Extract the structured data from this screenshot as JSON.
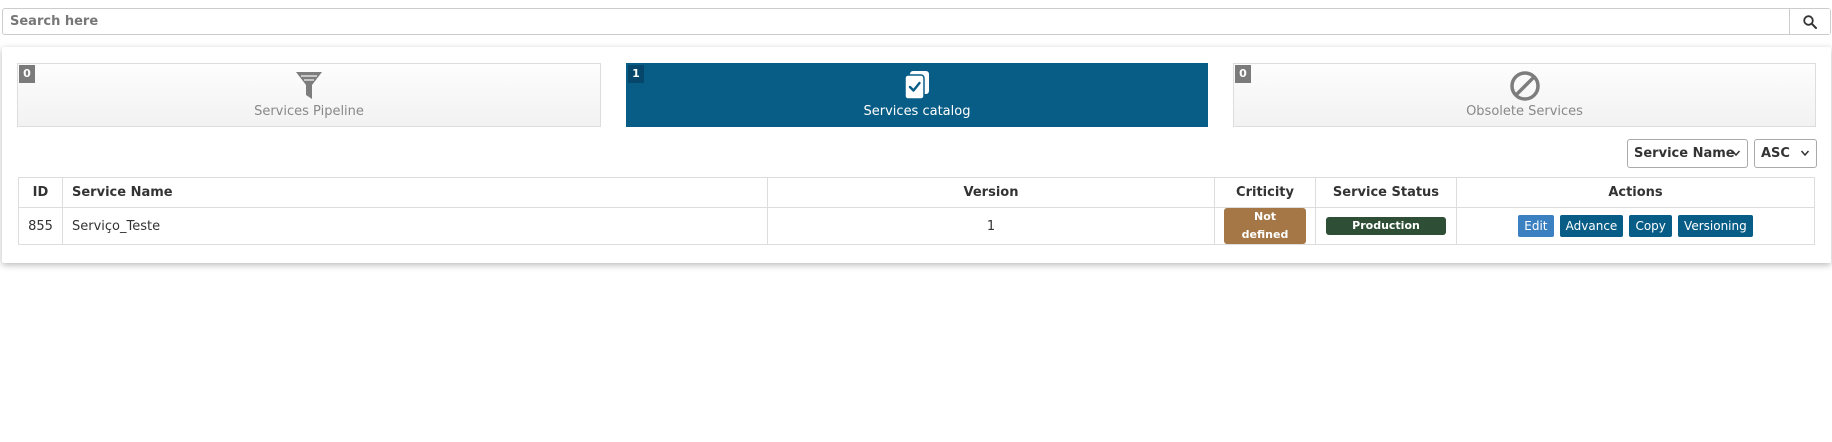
{
  "search": {
    "placeholder": "Search here",
    "value": ""
  },
  "tiles": [
    {
      "count": "0",
      "label": "Services Pipeline",
      "icon": "funnel-icon",
      "active": false
    },
    {
      "count": "1",
      "label": "Services catalog",
      "icon": "catalog-check-icon",
      "active": true
    },
    {
      "count": "0",
      "label": "Obsolete Services",
      "icon": "prohibited-icon",
      "active": false
    }
  ],
  "sort": {
    "field": "Service Name",
    "order": "ASC"
  },
  "table": {
    "headers": [
      "ID",
      "Service Name",
      "Version",
      "Criticity",
      "Service Status",
      "Actions"
    ],
    "rows": [
      {
        "id": "855",
        "name": "Serviço_Teste",
        "version": "1",
        "criticity": "Not defined",
        "status": "Production",
        "actions": [
          "Edit",
          "Advance",
          "Copy",
          "Versioning"
        ]
      }
    ]
  },
  "colors": {
    "active_tile": "#085d87",
    "criticity_badge": "#a57747",
    "status_badge": "#2e4f35",
    "edit_button": "#3b80c1",
    "action_button": "#085d87"
  }
}
